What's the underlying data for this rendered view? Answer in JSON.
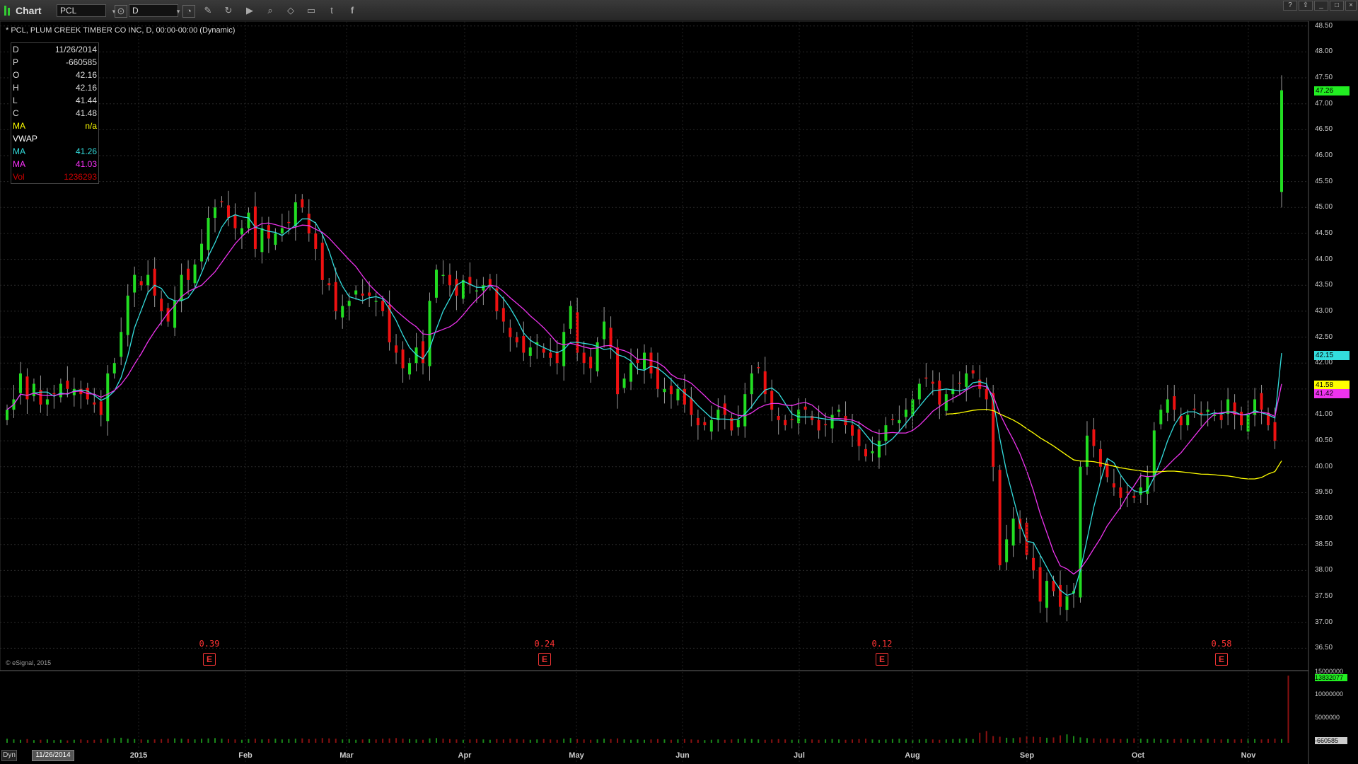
{
  "app": {
    "title": "Chart",
    "symbol": "PCL",
    "interval": "D"
  },
  "toolbar": {
    "icons": [
      "cursor-icon",
      "crosshair-icon",
      "pencil-icon",
      "refresh-icon",
      "play-icon",
      "search-icon",
      "tag-icon",
      "chat-icon",
      "twitter-icon",
      "facebook-icon"
    ]
  },
  "window_controls": {
    "help": "?",
    "minimize": "_",
    "restore": "□",
    "close": "×"
  },
  "header": {
    "text": "* PCL, PLUM CREEK TIMBER CO INC, D, 00:00-00:00 (Dynamic)"
  },
  "data_window": {
    "rows": [
      {
        "label": "D",
        "value": "11/26/2014",
        "color": "#dddddd"
      },
      {
        "label": "P",
        "value": "-660585",
        "color": "#dddddd"
      },
      {
        "label": "O",
        "value": "42.16",
        "color": "#dddddd"
      },
      {
        "label": "H",
        "value": "42.16",
        "color": "#dddddd"
      },
      {
        "label": "L",
        "value": "41.44",
        "color": "#dddddd"
      },
      {
        "label": "C",
        "value": "41.48",
        "color": "#dddddd"
      },
      {
        "label": "MA",
        "value": "n/a",
        "color": "#ffff00"
      },
      {
        "label": "VWAP",
        "value": "",
        "color": "#ffffff"
      },
      {
        "label": "MA",
        "value": "41.26",
        "color": "#33dddd"
      },
      {
        "label": "MA",
        "value": "41.03",
        "color": "#ff33ff"
      },
      {
        "label": "Vol",
        "value": "1236293",
        "color": "#cc0000"
      }
    ]
  },
  "watermark": "© eSignal, 2015",
  "earnings": [
    {
      "value": "0.39",
      "icon": "E"
    },
    {
      "value": "0.24",
      "icon": "E"
    },
    {
      "value": "0.12",
      "icon": "E"
    },
    {
      "value": "0.58",
      "icon": "E"
    }
  ],
  "bottom": {
    "dyn_label": "Dyn",
    "date_label": "11/26/2014"
  },
  "colors": {
    "up": "#22dd22",
    "down": "#ee1111",
    "ma_fast": "#33dddd",
    "ma_slow": "#ee33ee",
    "ma_long": "#ffff00",
    "grid": "#2a2a2a"
  },
  "chart_data": {
    "type": "candlestick",
    "symbol": "PCL",
    "y_ticks": [
      "48.50",
      "48.00",
      "47.50",
      "47.00",
      "46.50",
      "46.00",
      "45.50",
      "45.00",
      "44.50",
      "44.00",
      "43.50",
      "43.00",
      "42.50",
      "42.00",
      "41.50",
      "41.00",
      "40.50",
      "40.00",
      "39.50",
      "39.00",
      "38.50",
      "38.00",
      "37.50",
      "37.00",
      "36.50"
    ],
    "ylim": [
      36.3,
      48.7
    ],
    "x_labels": [
      "2015",
      "Feb",
      "Mar",
      "Apr",
      "May",
      "Jun",
      "Jul",
      "Aug",
      "Sep",
      "Oct",
      "Nov"
    ],
    "price_tags": [
      {
        "value": "47.26",
        "color": "#22ee22"
      },
      {
        "value": "42.15",
        "color": "#33dddd"
      },
      {
        "value": "41.58",
        "color": "#ffff00"
      },
      {
        "value": "41.42",
        "color": "#ee33ee"
      }
    ],
    "closes": [
      41.1,
      41.3,
      41.8,
      41.3,
      41.6,
      41.2,
      41.3,
      41.4,
      41.6,
      41.5,
      41.5,
      41.4,
      41.3,
      41.2,
      41.0,
      41.8,
      42.0,
      42.6,
      43.3,
      43.7,
      43.5,
      43.7,
      43.3,
      43.0,
      42.8,
      43.2,
      43.7,
      43.6,
      43.9,
      44.3,
      44.8,
      45.0,
      45.1,
      44.8,
      44.6,
      44.6,
      44.9,
      44.2,
      44.6,
      44.4,
      44.5,
      44.6,
      44.7,
      45.1,
      45.0,
      44.5,
      44.2,
      43.6,
      43.5,
      43.0,
      43.1,
      43.2,
      43.4,
      43.3,
      43.3,
      43.2,
      43.0,
      42.4,
      42.2,
      41.9,
      42.0,
      42.3,
      42.0,
      43.2,
      43.8,
      43.7,
      43.5,
      43.3,
      43.6,
      43.5,
      43.4,
      43.5,
      43.5,
      43.0,
      42.8,
      42.5,
      42.4,
      42.2,
      42.3,
      42.4,
      42.2,
      42.1,
      42.0,
      42.6,
      43.1,
      42.2,
      42.0,
      41.9,
      42.4,
      42.8,
      42.3,
      41.4,
      41.7,
      42.0,
      42.0,
      42.2,
      41.8,
      41.5,
      41.5,
      41.4,
      41.5,
      41.2,
      41.0,
      40.8,
      40.8,
      40.9,
      41.1,
      41.0,
      40.7,
      40.9,
      41.4,
      41.8,
      41.9,
      41.4,
      41.1,
      40.9,
      40.8,
      40.9,
      41.1,
      41.1,
      40.9,
      40.7,
      40.8,
      41.0,
      41.1,
      40.8,
      40.6,
      40.4,
      40.2,
      40.3,
      40.5,
      40.8,
      40.9,
      40.9,
      41.1,
      41.3,
      41.6,
      41.7,
      41.6,
      41.2,
      41.4,
      41.5,
      41.6,
      41.8,
      41.8,
      41.5,
      41.3,
      40.0,
      38.1,
      38.6,
      39.0,
      38.8,
      38.3,
      38.0,
      37.4,
      37.8,
      37.6,
      37.3,
      37.5,
      37.6,
      40.0,
      40.6,
      40.4,
      40.0,
      39.8,
      39.6,
      39.4,
      39.5,
      39.4,
      39.6,
      39.8,
      40.7,
      41.1,
      41.3,
      41.1,
      40.8,
      41.0,
      41.1,
      41.0,
      41.1,
      41.0,
      40.9,
      41.3,
      41.0,
      40.8,
      41.0,
      41.3,
      41.1,
      40.8,
      40.5,
      47.26
    ],
    "volumes": [
      12,
      10,
      9,
      11,
      8,
      9,
      10,
      8,
      9,
      7,
      9,
      10,
      8,
      9,
      11,
      12,
      14,
      15,
      12,
      11,
      10,
      9,
      10,
      11,
      12,
      13,
      12,
      11,
      10,
      12,
      13,
      14,
      12,
      11,
      10,
      9,
      11,
      12,
      10,
      11,
      12,
      10,
      11,
      12,
      13,
      11,
      12,
      14,
      13,
      12,
      10,
      11,
      9,
      10,
      11,
      10,
      12,
      13,
      14,
      12,
      11,
      10,
      9,
      13,
      14,
      12,
      11,
      10,
      9,
      10,
      11,
      10,
      9,
      11,
      10,
      12,
      11,
      10,
      9,
      10,
      11,
      10,
      9,
      12,
      14,
      11,
      10,
      9,
      10,
      12,
      11,
      13,
      10,
      9,
      10,
      9,
      10,
      11,
      10,
      9,
      10,
      11,
      10,
      9,
      8,
      9,
      10,
      9,
      10,
      11,
      12,
      11,
      10,
      9,
      10,
      11,
      10,
      9,
      10,
      11,
      10,
      9,
      10,
      11,
      10,
      9,
      10,
      11,
      12,
      10,
      9,
      10,
      11,
      12,
      10,
      9,
      10,
      11,
      10,
      9,
      10,
      11,
      12,
      13,
      11,
      30,
      35,
      20,
      18,
      15,
      14,
      16,
      20,
      18,
      17,
      15,
      16,
      22,
      25,
      20,
      16,
      14,
      13,
      12,
      13,
      12,
      11,
      12,
      13,
      12,
      11,
      12,
      11,
      10,
      11,
      12,
      11,
      10,
      11,
      12,
      11,
      10,
      11,
      10,
      11,
      12,
      11,
      10,
      11,
      12,
      11,
      200
    ],
    "volume_labels": [
      "15000000",
      "13832077",
      "10000000",
      "5000000",
      "-660585"
    ],
    "volume_max": 15000000
  }
}
